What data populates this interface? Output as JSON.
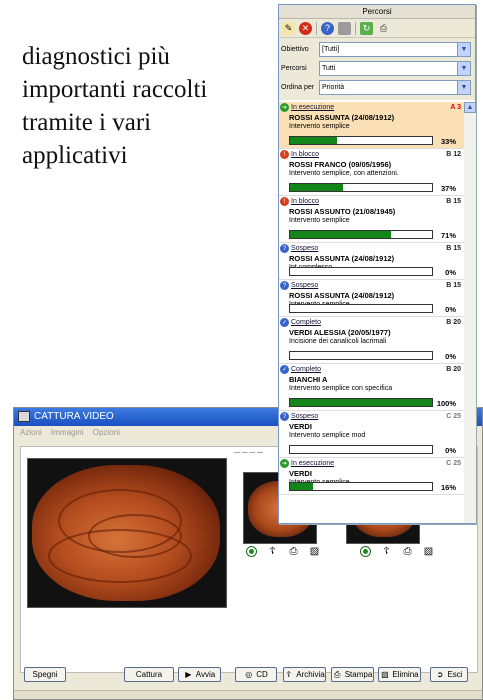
{
  "caption": {
    "line1": "diagnostici più",
    "line2": "importanti raccolti",
    "line3": "tramite i vari",
    "line4": "applicativi"
  },
  "capture_window": {
    "title": "CATTURA VIDEO",
    "menu": [
      "Azioni",
      "Immagini",
      "Opzioni"
    ],
    "thumb_label": "— — — —",
    "buttons": {
      "spegni": "Spegni",
      "cattura": "Cattura",
      "avvia": "Avvia",
      "cd": "CD",
      "archivia": "Archivia",
      "stampa": "Stampa",
      "elimina": "Elimina",
      "esci": "Esci"
    }
  },
  "percorsi": {
    "title": "Percorsi",
    "filters": {
      "obiettivo_label": "Obiettivo",
      "obiettivo_value": "[Tutti]",
      "percorsi_label": "Percorsi",
      "percorsi_value": "Tutti",
      "ordina_label": "Ordina per",
      "ordina_value": "Priorità"
    },
    "items": [
      {
        "status": "In esecuzione",
        "code": "A 3",
        "name": "ROSSI ASSUNTA (24/08/1912)",
        "desc": "Intervento semplice",
        "pct": "33%",
        "progress": 0.33
      },
      {
        "status": "In blocco",
        "code": "B 12",
        "name": "ROSSI FRANCO (09/05/1956)",
        "desc": "Intervento semplice, con attenzioni.",
        "pct": "37%",
        "progress": 0.37
      },
      {
        "status": "In blocco",
        "code": "B 15",
        "name": "ROSSI ASSUNTO (21/08/1945)",
        "desc": "Intervento semplice",
        "pct": "71%",
        "progress": 0.71
      },
      {
        "status": "Sospeso",
        "code": "B 15",
        "name": "ROSSI ASSUNTA (24/08/1912)",
        "desc": "Int complesso",
        "pct": "0%",
        "progress": 0
      },
      {
        "status": "Sospeso",
        "code": "B 15",
        "name": "ROSSI ASSUNTA (24/08/1912)",
        "desc": "Intervento semplice",
        "pct": "0%",
        "progress": 0
      },
      {
        "status": "Completo",
        "code": "B 20",
        "name": "VERDI ALESSIA (20/05/1977)",
        "desc": "Incisione dei canalicoli lacrimali",
        "pct": "0%",
        "progress": 0
      },
      {
        "status": "Completo",
        "code": "B 20",
        "name": "BIANCHI A",
        "desc": "Intervento semplice con specifica",
        "pct": "100%",
        "progress": 1
      },
      {
        "status": "Sospeso",
        "code": "C 25",
        "name": "VERDI",
        "desc": "Intervento semplice mod",
        "pct": "0%",
        "progress": 0
      },
      {
        "status": "In esecuzione",
        "code": "C 25",
        "name": "VERDI",
        "desc": "Intervento semplice",
        "pct": "16%",
        "progress": 0.16
      }
    ]
  },
  "colors": {
    "progress": "#13861a",
    "selected_row": "#fbe0b6",
    "status_running": "#2a9a2a",
    "status_blocked": "#d9401a",
    "status_suspended": "#3a63c8",
    "status_complete": "#3a63c8"
  }
}
